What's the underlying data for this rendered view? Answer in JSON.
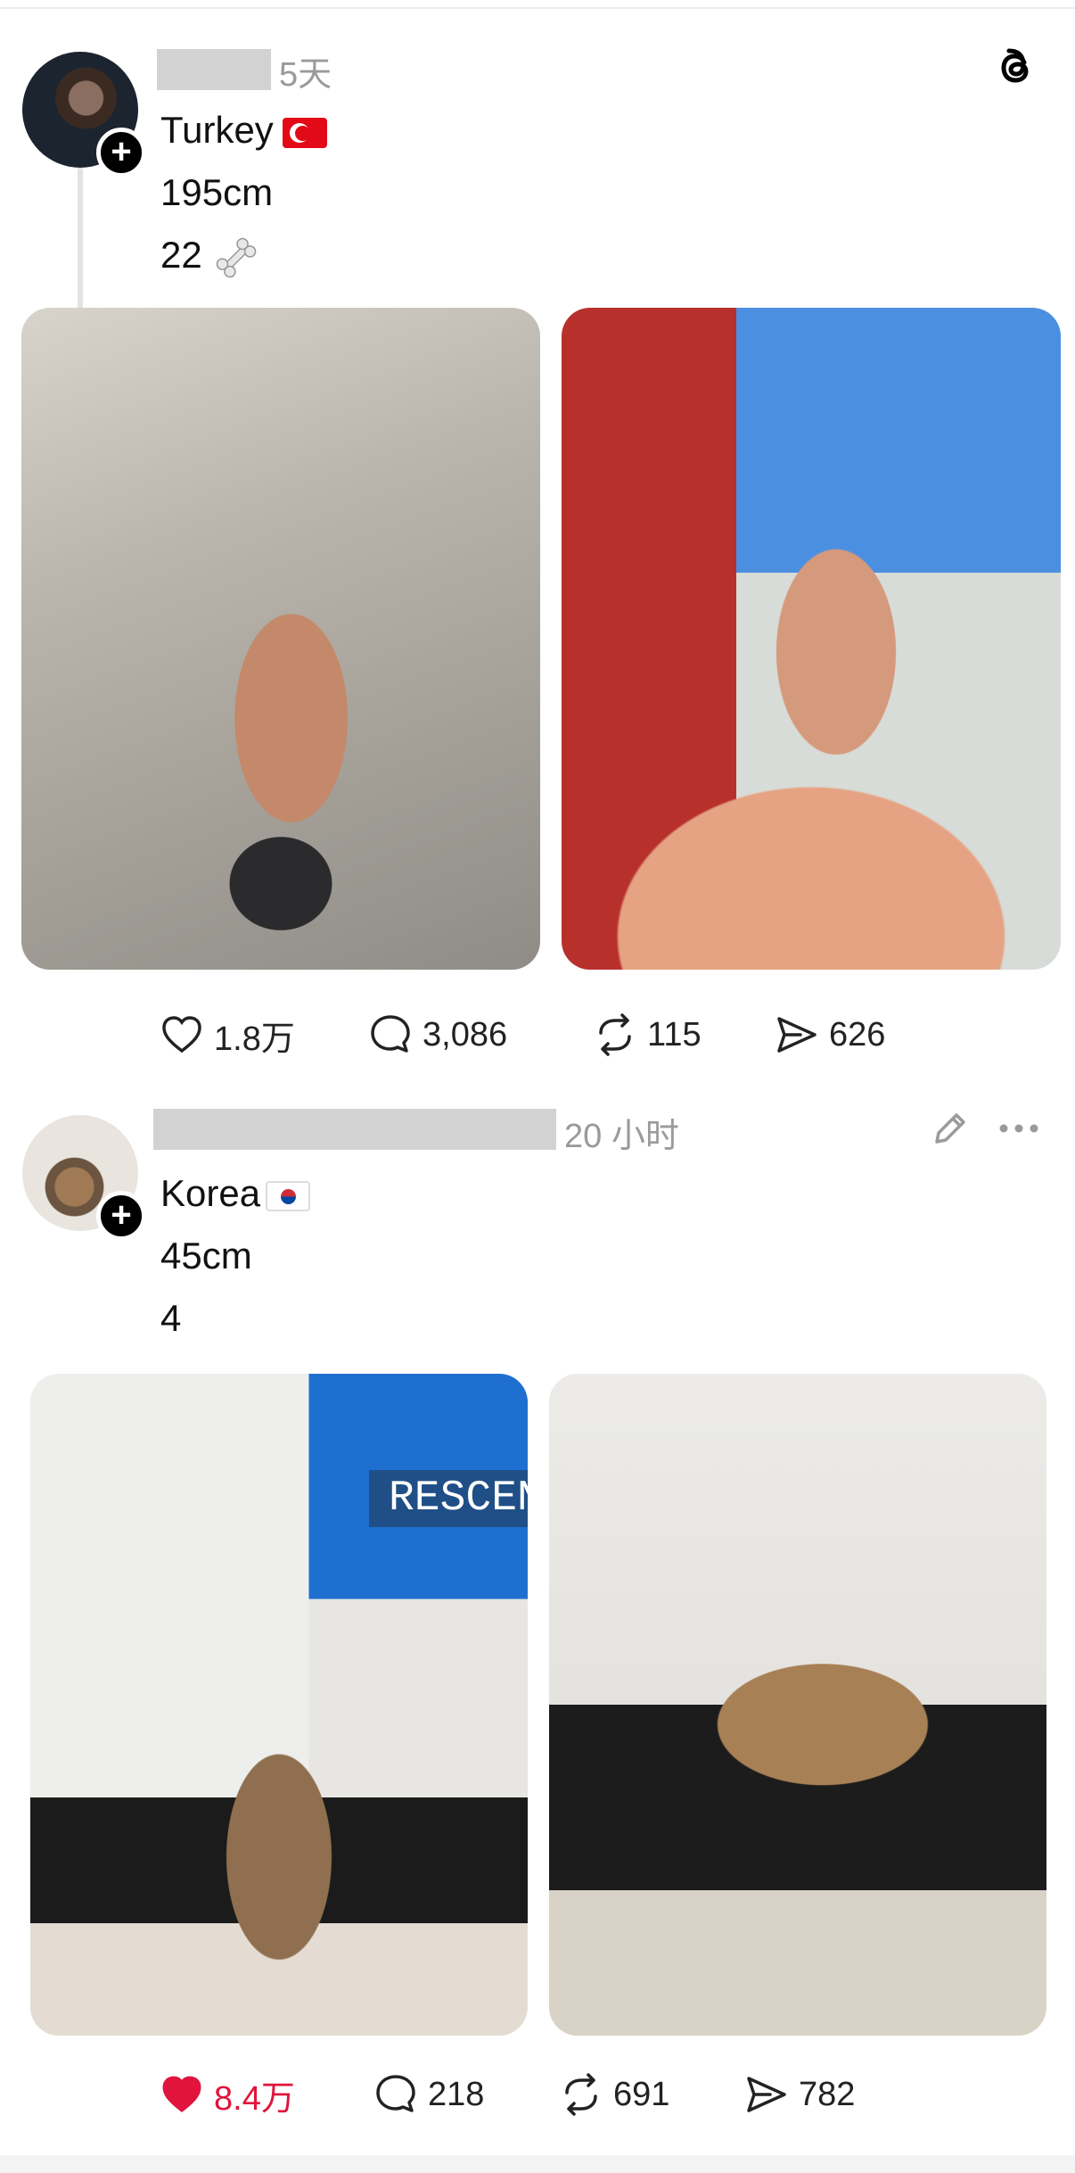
{
  "posts": [
    {
      "time": "5天",
      "lines": [
        "Turkey",
        "195cm",
        "22"
      ],
      "flag": "flag-turkey",
      "emoji": "bone-icon",
      "actions": {
        "likes": "1.8万",
        "comments": "3,086",
        "reposts": "115",
        "shares": "626"
      },
      "liked": false
    },
    {
      "time": "20 小时",
      "lines": [
        "Korea",
        "45cm",
        "4"
      ],
      "flag": "flag-south-korea",
      "actions": {
        "likes": "8.4万",
        "comments": "218",
        "reposts": "691",
        "shares": "782"
      },
      "liked": true
    }
  ],
  "photos": {
    "p3_screen_text": "RESCEN"
  },
  "colors": {
    "liked_red": "#e0143c",
    "icon_gray": "#9a9a9a"
  }
}
